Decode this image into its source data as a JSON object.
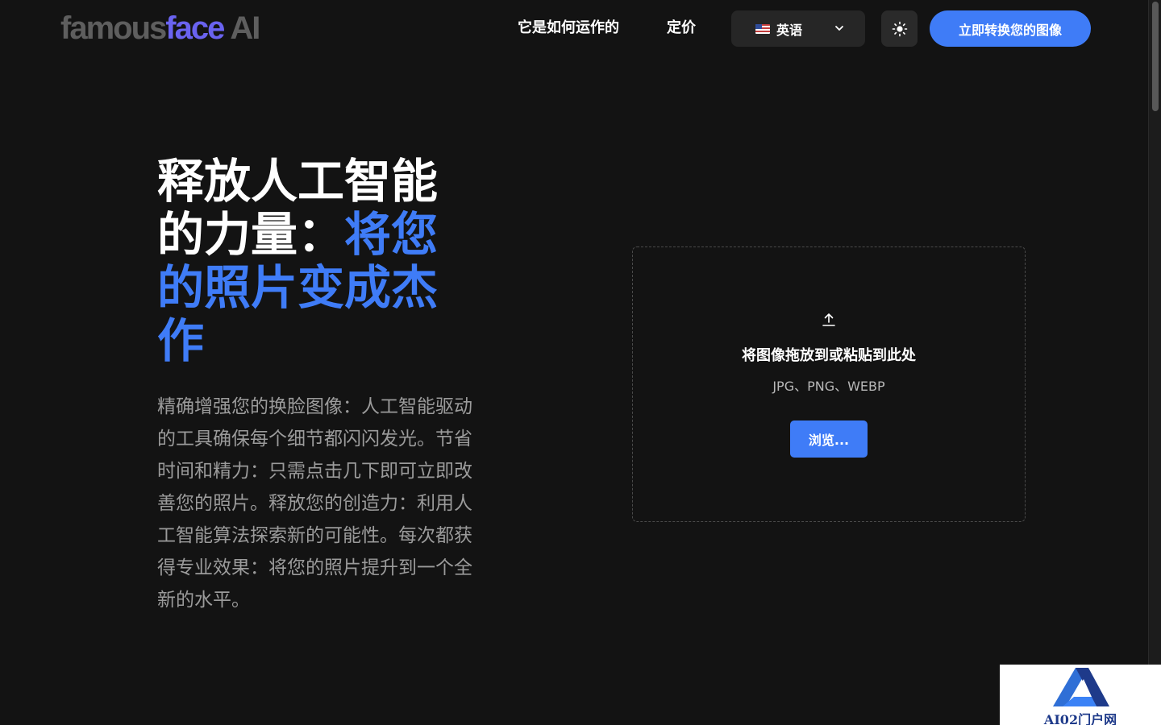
{
  "header": {
    "logo": {
      "part1": "famous",
      "part2": "face",
      "part3": "AI"
    },
    "nav": {
      "how_it_works": "它是如何运作的",
      "pricing": "定价"
    },
    "language": {
      "selected": "英语"
    },
    "cta_label": "立即转换您的图像"
  },
  "hero": {
    "title_white_1": "释放人工智能的力量：",
    "title_accent": "将您的照片变成杰作",
    "description": "精确增强您的换脸图像：人工智能驱动的工具确保每个细节都闪闪发光。节省时间和精力：只需点击几下即可立即改善您的照片。释放您的创造力：利用人工智能算法探索新的可能性。每次都获得专业效果：将您的照片提升到一个全新的水平。"
  },
  "upload": {
    "title": "将图像拖放到或粘贴到此处",
    "formats": "JPG、PNG、WEBP",
    "browse_label": "浏览..."
  },
  "watermark": {
    "text": "AI02门户网"
  },
  "colors": {
    "background": "#131313",
    "accent": "#3f7cf7",
    "logo_face": "#6a63f0",
    "logo_gray": "#5e5e5e"
  },
  "icons": {
    "upload": "upload-arrow-icon",
    "theme": "sun-icon",
    "dropdown": "chevron-down-icon",
    "flag": "us-flag-icon"
  }
}
